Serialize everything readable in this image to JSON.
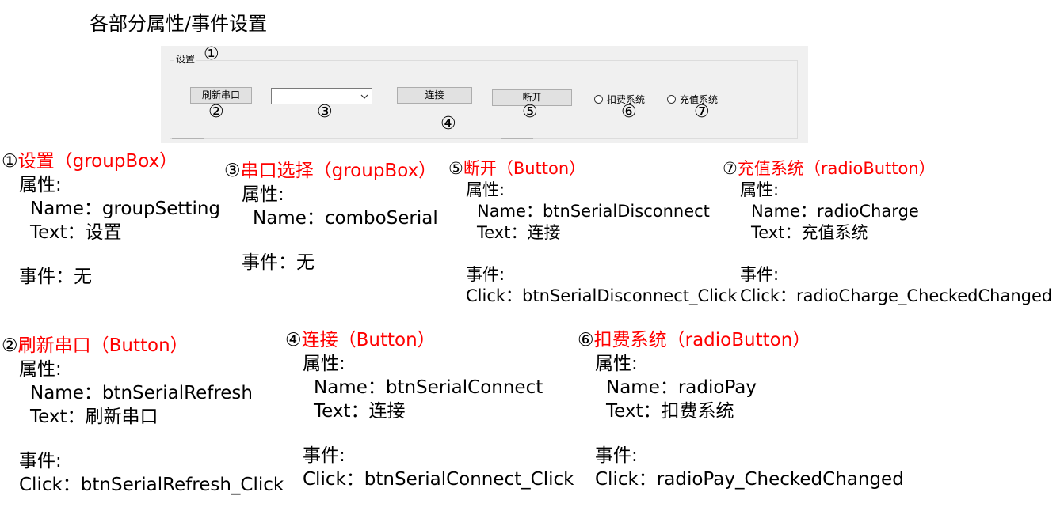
{
  "page_title": "各部分属性/事件设置",
  "form": {
    "group_label": "设置",
    "refresh_button": "刷新串口",
    "combo_value": "",
    "connect_button": "连接",
    "disconnect_button": "断开",
    "radio_pay": "扣费系统",
    "radio_charge": "充值系统",
    "markers": [
      "①",
      "②",
      "③",
      "④",
      "⑤",
      "⑥",
      "⑦"
    ]
  },
  "annotations": {
    "groupbox": {
      "marker": "①",
      "title": "设置（groupBox）",
      "props_header": "属性:",
      "name": "Name：groupSetting",
      "text": "Text：设置",
      "events": "事件：无"
    },
    "combo": {
      "marker": "③",
      "title": "串口选择（groupBox）",
      "props_header": "属性:",
      "name": "Name：comboSerial",
      "events": "事件：无"
    },
    "disconnect": {
      "marker": "⑤",
      "title": "断开（Button）",
      "props_header": "属性:",
      "name": "Name：btnSerialDisconnect",
      "text": "Text：连接",
      "events_header": "事件:",
      "click": "Click：btnSerialDisconnect_Click"
    },
    "charge": {
      "marker": "⑦",
      "title": "充值系统（radioButton）",
      "props_header": "属性:",
      "name": "Name：radioCharge",
      "text": "Text：充值系统",
      "events_header": "事件:",
      "click": "Click：radioCharge_CheckedChanged"
    },
    "refresh": {
      "marker": "②",
      "title": "刷新串口（Button）",
      "props_header": "属性:",
      "name": "Name：btnSerialRefresh",
      "text": "Text：刷新串口",
      "events_header": "事件:",
      "click": "Click：btnSerialRefresh_Click"
    },
    "connect": {
      "marker": "④",
      "title": "连接（Button）",
      "props_header": "属性:",
      "name": "Name：btnSerialConnect",
      "text": "Text：连接",
      "events_header": "事件:",
      "click": "Click：btnSerialConnect_Click"
    },
    "pay": {
      "marker": "⑥",
      "title": "扣费系统（radioButton）",
      "props_header": "属性:",
      "name": "Name：radioPay",
      "text": "Text：扣费系统",
      "events_header": "事件:",
      "click": "Click：radioPay_CheckedChanged"
    }
  }
}
